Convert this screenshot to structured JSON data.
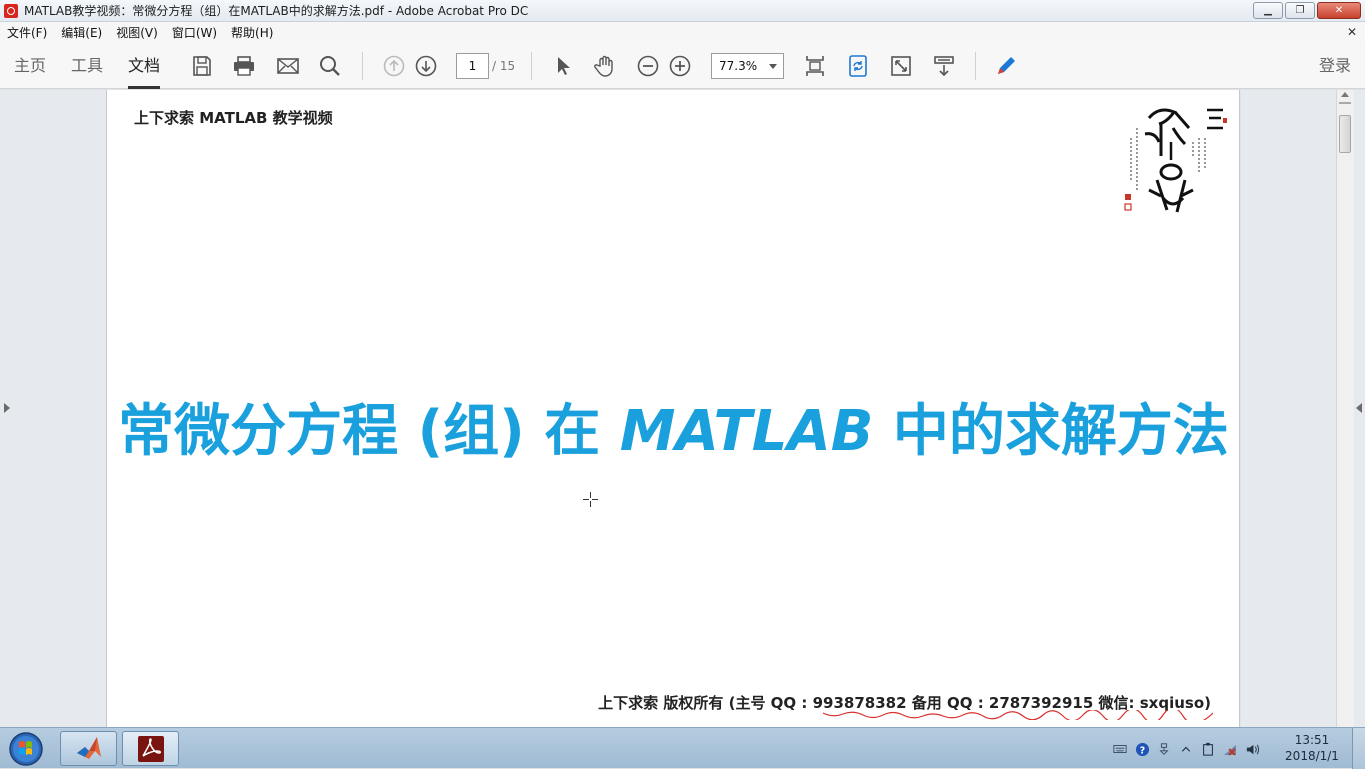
{
  "window": {
    "title": "MATLAB教学视频：常微分方程（组）在MATLAB中的求解方法.pdf - Adobe Acrobat Pro DC",
    "controls": {
      "minimize": "▁",
      "maximize": "❐",
      "close": "✕"
    }
  },
  "menu": {
    "items": [
      "文件(F)",
      "编辑(E)",
      "视图(V)",
      "窗口(W)",
      "帮助(H)"
    ],
    "close_glyph": "✕"
  },
  "toolbar": {
    "tabs": [
      "主页",
      "工具",
      "文档"
    ],
    "active_tab": "文档",
    "current_page": "1",
    "total_pages": "/ 15",
    "zoom": "77.3%",
    "sign_in": "登录",
    "accent": "#1c78d4"
  },
  "document": {
    "header": "上下求索 MATLAB 教学视频",
    "title_prefix": "常微分方程 (组) 在 ",
    "title_latin": "MATLAB",
    "title_suffix": " 中的求解方法",
    "title_color": "#1aa0dd",
    "footer": "上下求索  版权所有  (主号 QQ : 993878382   备用 QQ : 2787392915   微信: sxqiuso)"
  },
  "taskbar": {
    "time": "13:51",
    "date": "2018/1/1",
    "apps": [
      "matlab-icon",
      "acrobat-icon"
    ]
  }
}
